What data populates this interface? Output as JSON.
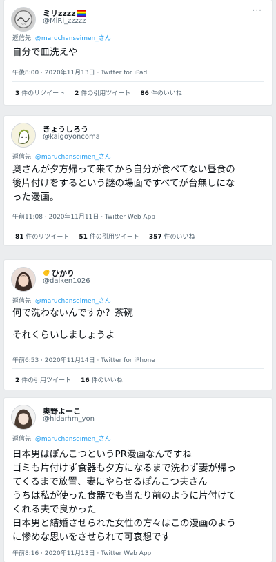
{
  "tweets": [
    {
      "name": "ミリzzzz",
      "handle": "@MiRi_zzzzz",
      "reply_prefix": "返信先:",
      "reply_to": "@maruchanseimen_さん",
      "lines": [
        "自分で皿洗えや"
      ],
      "meta": "午後8:00 · 2020年11月13日 · Twitter for iPad",
      "stats": [
        {
          "num": "3",
          "label": "件のリツイート"
        },
        {
          "num": "2",
          "label": "件の引用ツイート"
        },
        {
          "num": "86",
          "label": "件のいいね"
        }
      ]
    },
    {
      "name": "きょうしろう",
      "handle": "@kaigoyoncoma",
      "reply_prefix": "返信先:",
      "reply_to": "@maruchanseimen_さん",
      "lines": [
        "奥さんが夕方帰って来てから自分が食べてない昼食の",
        "後片付けをするという謎の場面ですべてが台無しにな",
        "った漫画。"
      ],
      "meta": "午前11:08 · 2020年11月11日 · Twitter Web App",
      "stats": [
        {
          "num": "81",
          "label": "件のリツイート"
        },
        {
          "num": "51",
          "label": "件の引用ツイート"
        },
        {
          "num": "357",
          "label": "件のいいね"
        }
      ]
    },
    {
      "name": "ひかり",
      "handle": "@daiken1026",
      "reply_prefix": "返信先:",
      "reply_to": "@maruchanseimen_さん",
      "lines": [
        "何で洗わないんですか？茶碗",
        "",
        "それくらいしましょうよ"
      ],
      "meta": "午前6:53 · 2020年11月14日 · Twitter for iPhone",
      "stats": [
        {
          "num": "2",
          "label": "件の引用ツイート"
        },
        {
          "num": "16",
          "label": "件のいいね"
        }
      ]
    },
    {
      "name": "奥野よーこ",
      "handle": "@hidarhm_yon",
      "reply_prefix": "返信先:",
      "reply_to": "@maruchanseimen_さん",
      "lines": [
        "日本男はぽんこつというPR漫画なんですね",
        "ゴミも片付けず食器も夕方になるまで洗わず妻が帰っ",
        "てくるまで放置、妻にやらせるぽんこつ夫さん",
        "うちは私が使った食器でも当たり前のように片付けて",
        "くれる夫で良かった",
        "日本男と結婚させられた女性の方々はこの漫画のよう",
        "に惨めな思いをさせられて可哀想です"
      ],
      "meta": "午前8:16 · 2020年11月13日 · Twitter Web App"
    }
  ],
  "more_label": "···"
}
